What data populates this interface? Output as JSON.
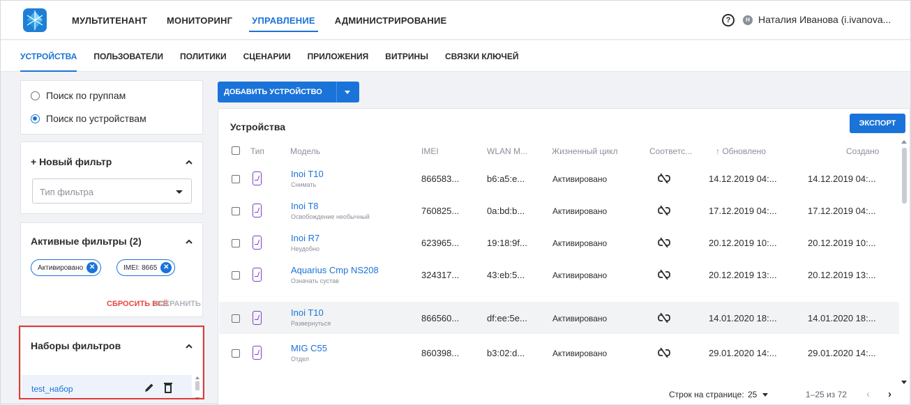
{
  "topnav": {
    "items": [
      "МУЛЬТИТЕНАНТ",
      "МОНИТОРИНГ",
      "УПРАВЛЕНИЕ",
      "АДМИНИСТРИРОВАНИЕ"
    ],
    "active": "УПРАВЛЕНИЕ",
    "help_symbol": "?",
    "avatar_initial": "Н",
    "user": "Наталия Иванова (i.ivanova..."
  },
  "subnav": {
    "items": [
      "УСТРОЙСТВА",
      "ПОЛЬЗОВАТЕЛИ",
      "ПОЛИТИКИ",
      "СЦЕНАРИИ",
      "ПРИЛОЖЕНИЯ",
      "ВИТРИНЫ",
      "СВЯЗКИ КЛЮЧЕЙ"
    ],
    "active": "УСТРОЙСТВА"
  },
  "search_mode": {
    "options": [
      "Поиск по группам",
      "Поиск по устройствам"
    ],
    "selected": "Поиск по устройствам"
  },
  "new_filter": {
    "title": "+ Новый фильтр",
    "placeholder": "Тип фильтра"
  },
  "active_filters": {
    "title": "Активные фильтры (2)",
    "chips": [
      "Активировано",
      "IMEI: 8665"
    ],
    "chip_close_symbol": "✕",
    "reset_label": "СБРОСИТЬ ВСЁ",
    "save_label": "СОХРАНИТЬ"
  },
  "filter_sets": {
    "title": "Наборы фильтров",
    "items": [
      "test_набор"
    ]
  },
  "actions": {
    "add_device": "ДОБАВИТЬ УСТРОЙСТВО",
    "export": "ЭКСПОРТ"
  },
  "table": {
    "title": "Устройства",
    "columns": [
      "Тип",
      "Модель",
      "IMEI",
      "WLAN M...",
      "Жизненный цикл",
      "Соответс...",
      "↑ Обновлено",
      "Создано"
    ],
    "rows": [
      {
        "model": "Inoi T10",
        "sub": "Снимать",
        "imei": "866583...",
        "wlan": "b6:a5:e...",
        "lifecycle": "Активировано",
        "updated": "14.12.2019 04:...",
        "created": "14.12.2019 04:..."
      },
      {
        "model": "Inoi T8",
        "sub": "Освобождение необычный",
        "imei": "760825...",
        "wlan": "0a:bd:b...",
        "lifecycle": "Активировано",
        "updated": "17.12.2019 04:...",
        "created": "17.12.2019 04:..."
      },
      {
        "model": "Inoi R7",
        "sub": "Неудобно",
        "imei": "623965...",
        "wlan": "19:18:9f...",
        "lifecycle": "Активировано",
        "updated": "20.12.2019 10:...",
        "created": "20.12.2019 10:..."
      },
      {
        "model": "Aquarius Cmp NS208",
        "sub": "Означать сустав",
        "imei": "324317...",
        "wlan": "43:eb:5...",
        "lifecycle": "Активировано",
        "updated": "20.12.2019 13:...",
        "created": "20.12.2019 13:..."
      },
      {
        "model": "Inoi T10",
        "sub": "Развернуться",
        "imei": "866560...",
        "wlan": "df:ee:5e...",
        "lifecycle": "Активировано",
        "updated": "14.01.2020 18:...",
        "created": "14.01.2020 18:..."
      },
      {
        "model": "MIG C55",
        "sub": "Отдел",
        "imei": "860398...",
        "wlan": "b3:02:d...",
        "lifecycle": "Активировано",
        "updated": "29.01.2020 14:...",
        "created": "29.01.2020 14:..."
      }
    ],
    "highlighted_row": 4
  },
  "pagination": {
    "rows_per_page_label": "Строк на странице:",
    "rows_per_page": "25",
    "range": "1–25 из 72",
    "prev_symbol": "‹",
    "next_symbol": "›"
  },
  "colors": {
    "accent": "#1a73d9",
    "danger": "#e8473c",
    "device_icon": "#7b3fc4",
    "highlight_box": "#e53935"
  }
}
